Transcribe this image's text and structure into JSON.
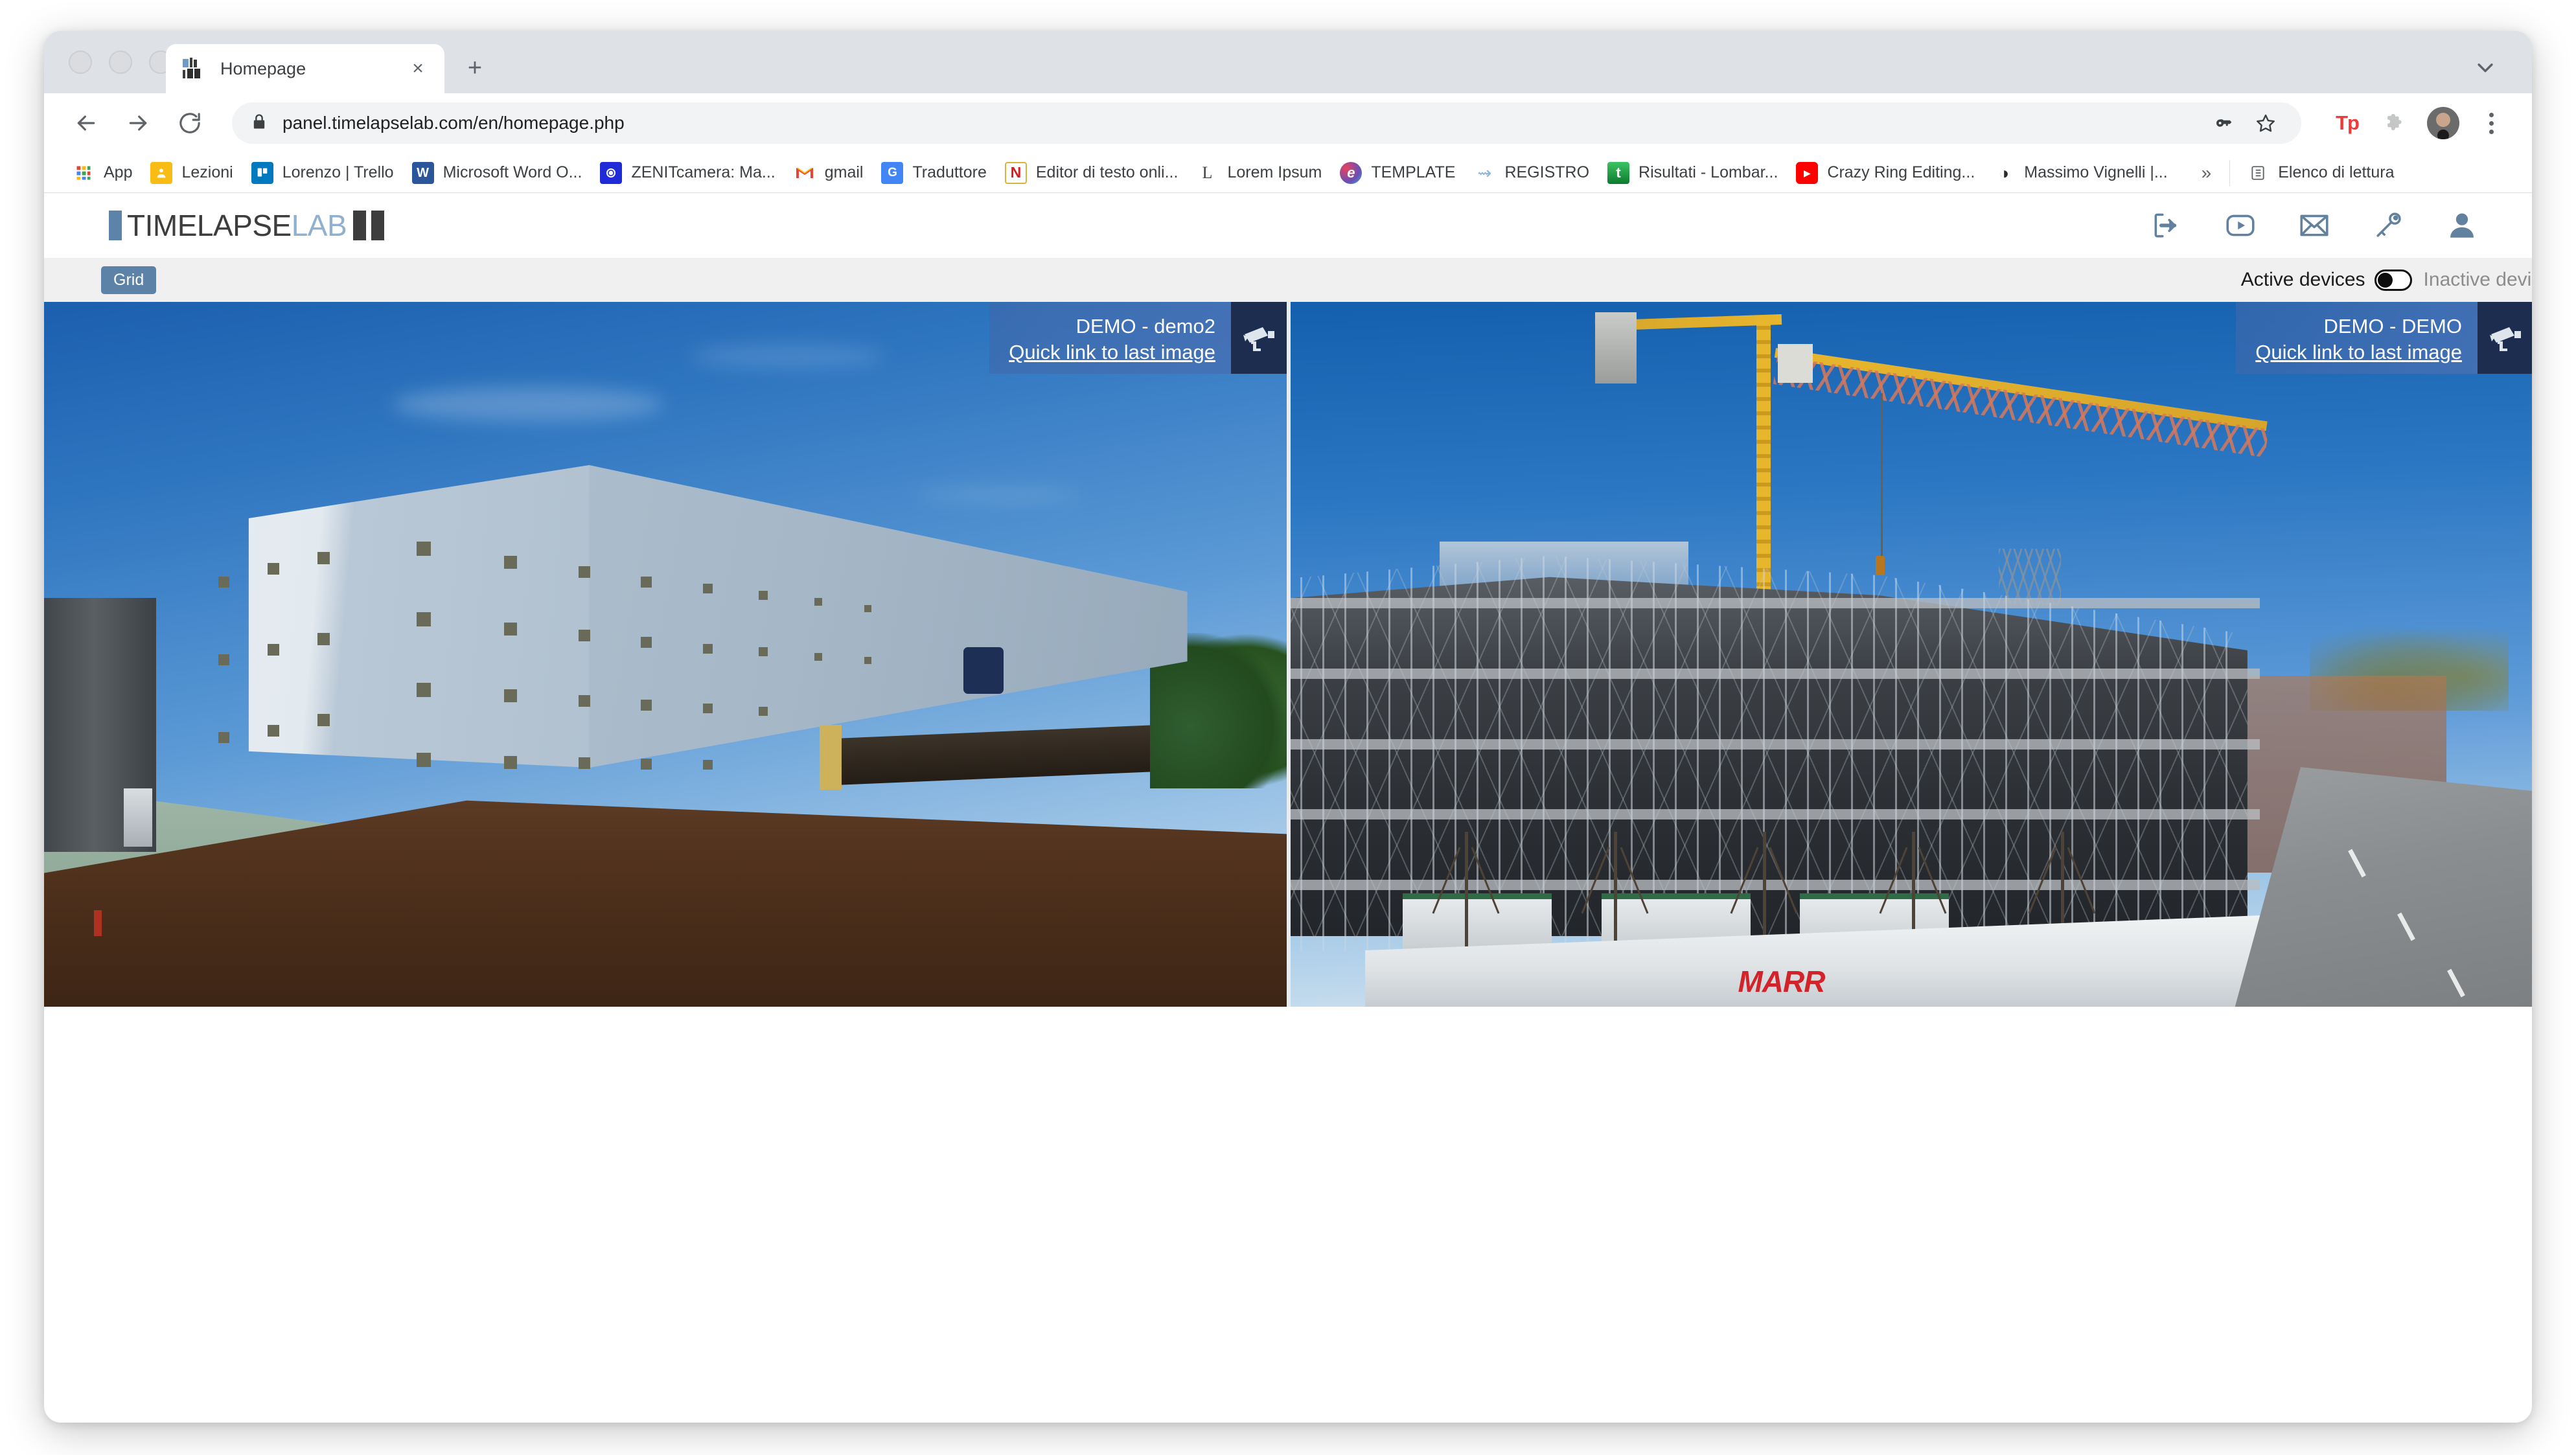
{
  "browser": {
    "window_controls": [
      "close",
      "minimize",
      "maximize"
    ],
    "tab": {
      "title": "Homepage",
      "favicon_name": "timelapselab-favicon",
      "close_label": "×"
    },
    "new_tab_label": "+",
    "window_chevron_name": "chevron-down-icon",
    "toolbar": {
      "back_name": "back-arrow-icon",
      "forward_name": "forward-arrow-icon",
      "reload_name": "reload-icon",
      "lock_name": "lock-icon",
      "url_secure": "panel.timelapselab.com",
      "url_path": "/en/homepage.php",
      "url_full": "panel.timelapselab.com/en/homepage.php",
      "key_icon_name": "password-key-icon",
      "star_icon_name": "bookmark-star-icon",
      "extension_tp_label": "Tp",
      "puzzle_icon_name": "extensions-puzzle-icon",
      "profile_icon_name": "profile-avatar",
      "menu_icon_name": "three-dot-menu-icon"
    },
    "bookmarks": [
      {
        "label": "App",
        "icon": "apps-grid-icon",
        "glyph": "⁙",
        "bg": "",
        "fg": "#4285f4"
      },
      {
        "label": "Lezioni",
        "icon": "classroom-icon",
        "glyph": "▣",
        "bg": "#f9bc14",
        "fg": "#ffffff"
      },
      {
        "label": "Lorenzo | Trello",
        "icon": "trello-icon",
        "glyph": "▥",
        "bg": "#0079bf",
        "fg": "#ffffff"
      },
      {
        "label": "Microsoft Word O...",
        "icon": "word-icon",
        "glyph": "W",
        "bg": "#2b579a",
        "fg": "#ffffff"
      },
      {
        "label": "ZENITcamera: Ma...",
        "icon": "zenitcamera-icon",
        "glyph": "◎",
        "bg": "#1f2bd6",
        "fg": "#ffffff"
      },
      {
        "label": "gmail",
        "icon": "gmail-icon",
        "glyph": "M",
        "bg": "",
        "fg": "#ea4335"
      },
      {
        "label": "Traduttore",
        "icon": "google-translate-icon",
        "glyph": "G",
        "bg": "#4285f4",
        "fg": "#ffffff"
      },
      {
        "label": "Editor di testo onli...",
        "icon": "text-editor-icon",
        "glyph": "N",
        "bg": "",
        "fg": "#d41d1d"
      },
      {
        "label": "Lorem Ipsum",
        "icon": "lorem-ipsum-icon",
        "glyph": "L",
        "bg": "",
        "fg": "#3c4043"
      },
      {
        "label": "TEMPLATE",
        "icon": "evernote-template-icon",
        "glyph": "e",
        "bg": "",
        "fg": "#6a4fb5"
      },
      {
        "label": "REGISTRO",
        "icon": "registro-icon",
        "glyph": "⇝",
        "bg": "",
        "fg": "#8ab4d8"
      },
      {
        "label": "Risultati - Lombar...",
        "icon": "tuttocampo-icon",
        "glyph": "t",
        "bg": "#18a14a",
        "fg": "#ffffff"
      },
      {
        "label": "Crazy Ring Editing...",
        "icon": "youtube-icon",
        "glyph": "▶",
        "bg": "#ff0000",
        "fg": "#ffffff"
      },
      {
        "label": "Massimo Vignelli |...",
        "icon": "globe-icon",
        "glyph": "◑",
        "bg": "",
        "fg": "#2b2b2b"
      }
    ],
    "bookmarks_overflow_label": "»",
    "reading_list_label": "Elenco di lettura",
    "reading_list_icon": "reading-list-icon"
  },
  "app": {
    "logo": {
      "part1": "TIMELAPSE",
      "part2": "LAB"
    },
    "header_icons": [
      {
        "name": "logout-icon"
      },
      {
        "name": "video-player-icon"
      },
      {
        "name": "mail-envelope-icon"
      },
      {
        "name": "key-icon"
      },
      {
        "name": "user-account-icon"
      }
    ],
    "controls": {
      "grid_button_label": "Grid",
      "active_devices_label": "Active devices",
      "inactive_devices_label": "Inactive devices",
      "toggle_state": "active"
    },
    "cameras": [
      {
        "name": "DEMO - demo2",
        "link_label": "Quick link to last image",
        "badge_icon": "cctv-camera-icon",
        "scene": "white-warehouse"
      },
      {
        "name": "DEMO - DEMO",
        "link_label": "Quick link to last image",
        "badge_icon": "cctv-camera-icon",
        "scene": "construction-site",
        "scene_text": "MARR"
      }
    ]
  },
  "colors": {
    "brand_blue": "#5c84ab",
    "logo_light": "#8fb1cd",
    "caption_overlay": "#4a72b5",
    "badge_navy": "#1c2d4f",
    "page_bg": "#eeeeee"
  }
}
